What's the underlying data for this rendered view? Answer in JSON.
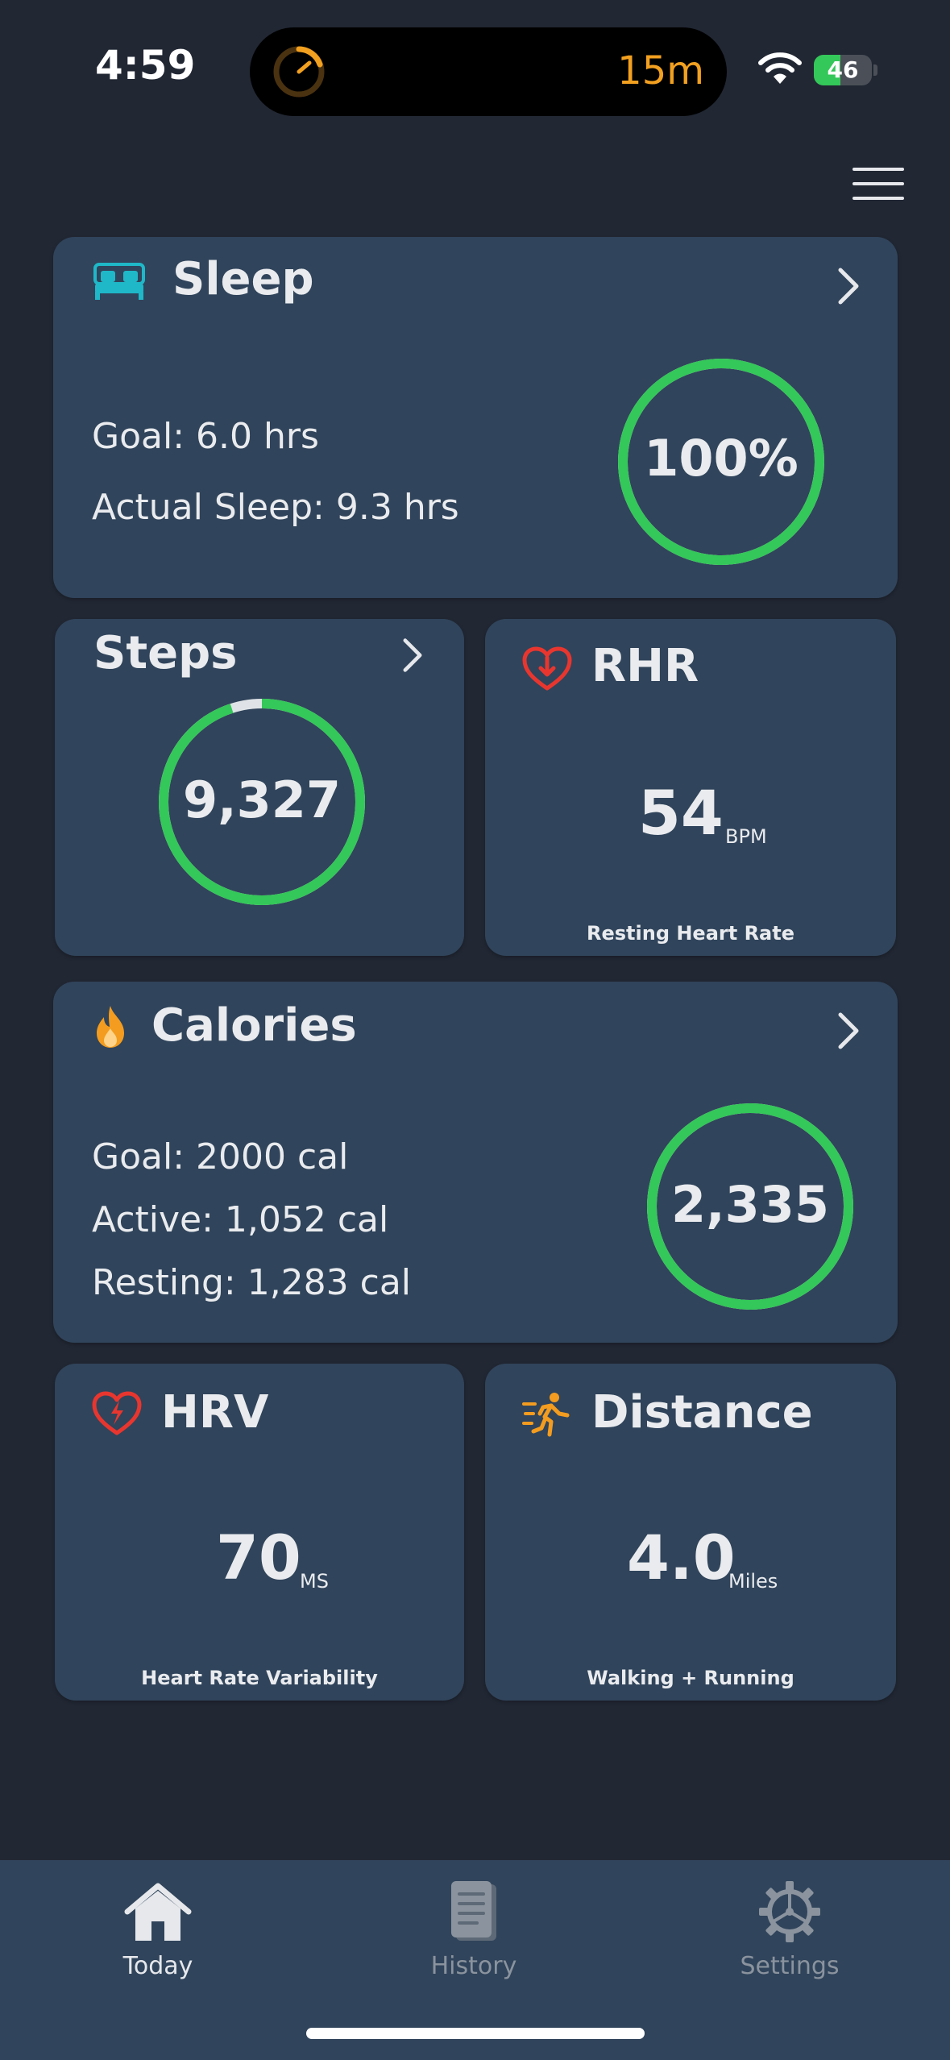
{
  "status_bar": {
    "time": "4:59",
    "live_activity_text": "15m",
    "battery_level": "46",
    "battery_percent": 46,
    "live_activity_color": "#f2a020"
  },
  "header": {
    "menu_icon": "hamburger-menu-icon"
  },
  "sleep": {
    "title": "Sleep",
    "icon": "bed-icon",
    "goal": "Goal: 6.0 hrs",
    "actual": "Actual Sleep: 9.3 hrs",
    "ring_label": "100%",
    "progress": 1.0
  },
  "steps": {
    "title": "Steps",
    "value": "9,327",
    "progress": 0.95
  },
  "rhr": {
    "title": "RHR",
    "icon": "heart-down-arrow-icon",
    "value": "54",
    "unit": "BPM",
    "caption": "Resting Heart Rate"
  },
  "calories": {
    "title": "Calories",
    "icon": "flame-icon",
    "goal": "Goal: 2000 cal",
    "active": "Active: 1,052 cal",
    "resting": "Resting: 1,283 cal",
    "ring_label": "2,335",
    "progress": 1.0
  },
  "hrv": {
    "title": "HRV",
    "icon": "heart-bolt-icon",
    "value": "70",
    "unit": "MS",
    "caption": "Heart Rate Variability"
  },
  "distance": {
    "title": "Distance",
    "icon": "running-person-icon",
    "value": "4.0",
    "unit": "Miles",
    "caption": "Walking + Running"
  },
  "tabbar": {
    "tabs": [
      {
        "label": "Today",
        "icon": "house-icon",
        "active": true
      },
      {
        "label": "History",
        "icon": "book-icon",
        "active": false
      },
      {
        "label": "Settings",
        "icon": "gear-icon",
        "active": false
      }
    ]
  },
  "colors": {
    "background": "#212733",
    "card": "#30445b",
    "ring_green": "#34c759",
    "accent_teal": "#1fb8c8",
    "heart_red": "#e8362f",
    "flame_orange": "#f39c1f"
  }
}
